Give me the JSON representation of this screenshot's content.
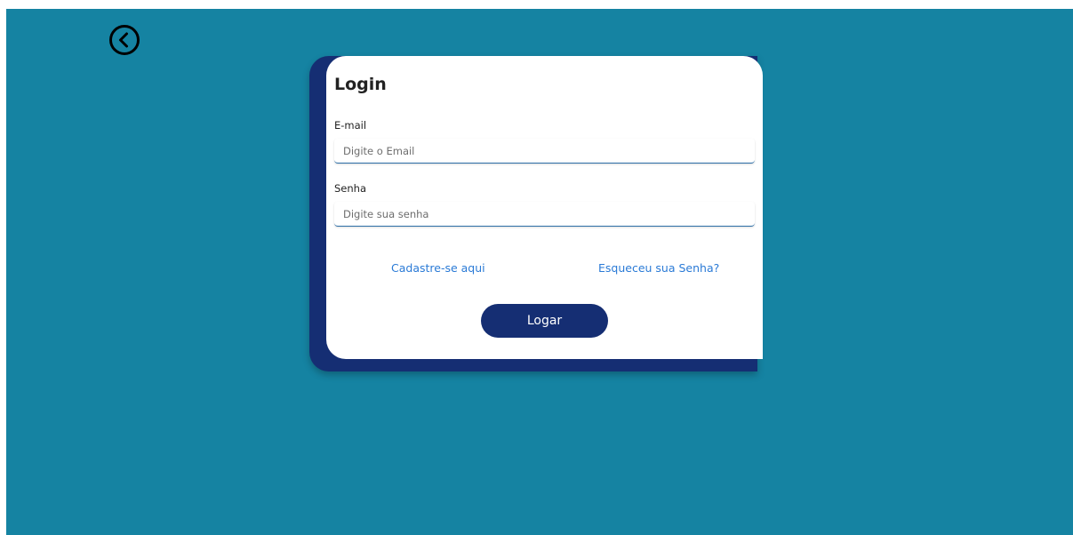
{
  "nav": {
    "back_icon": "chevron-left-circle-icon"
  },
  "login": {
    "title": "Login",
    "email": {
      "label": "E-mail",
      "placeholder": "Digite o Email",
      "value": ""
    },
    "password": {
      "label": "Senha",
      "placeholder": "Digite sua senha",
      "value": ""
    },
    "register_link": "Cadastre-se aqui",
    "forgot_link": "Esqueceu sua Senha?",
    "submit_label": "Logar"
  },
  "colors": {
    "background": "#1583a2",
    "accent_dark": "#152e73",
    "link": "#2a7ad6",
    "card": "#ffffff"
  }
}
